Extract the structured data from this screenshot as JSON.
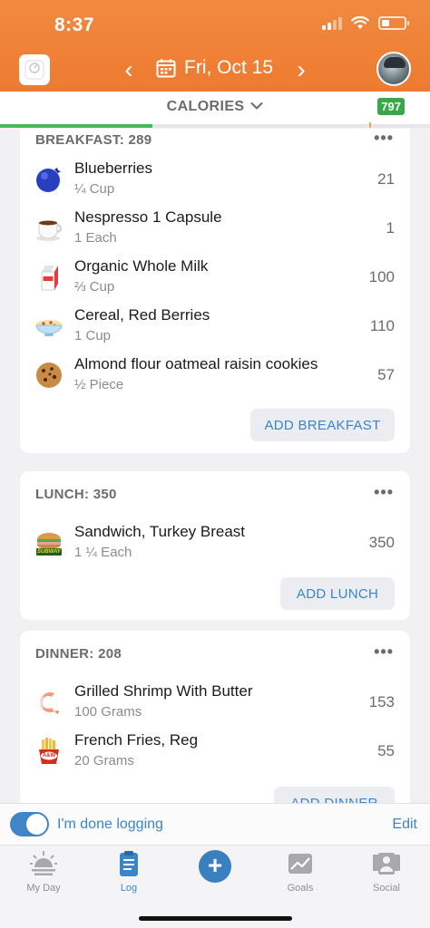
{
  "status_bar": {
    "time": "8:37"
  },
  "header": {
    "date_label": "Fri, Oct 15",
    "prev_glyph": "‹",
    "next_glyph": "›"
  },
  "metric": {
    "label": "CALORIES",
    "remaining_badge": "797",
    "progress_fraction": 0.355
  },
  "meals": {
    "breakfast": {
      "title": "BREAKFAST: 289",
      "more": "•••",
      "add_label": "ADD BREAKFAST",
      "items": [
        {
          "name": "Blueberries",
          "serving": "¼ Cup",
          "calories": "21",
          "icon": "blueberry-icon"
        },
        {
          "name": "Nespresso 1 Capsule",
          "serving": "1 Each",
          "calories": "1",
          "icon": "coffee-cup-icon"
        },
        {
          "name": "Organic Whole Milk",
          "serving": "⅔ Cup",
          "calories": "100",
          "icon": "milk-carton-icon"
        },
        {
          "name": "Cereal, Red Berries",
          "serving": "1 Cup",
          "calories": "110",
          "icon": "cereal-bowl-icon"
        },
        {
          "name": "Almond flour oatmeal raisin cookies",
          "serving": "½ Piece",
          "calories": "57",
          "icon": "cookie-icon"
        }
      ]
    },
    "lunch": {
      "title": "LUNCH: 350",
      "more": "•••",
      "add_label": "ADD LUNCH",
      "items": [
        {
          "name": "Sandwich, Turkey Breast",
          "serving": "1 ¼ Each",
          "calories": "350",
          "icon": "subway-sandwich-icon",
          "logo_text": "SUBWAY"
        }
      ]
    },
    "dinner": {
      "title": "DINNER: 208",
      "more": "•••",
      "add_label": "ADD DINNER",
      "items": [
        {
          "name": "Grilled Shrimp With Butter",
          "serving": "100 Grams",
          "calories": "153",
          "icon": "shrimp-icon"
        },
        {
          "name": "French Fries, Reg",
          "serving": "20 Grams",
          "calories": "55",
          "icon": "aw-fries-icon",
          "logo_text": "A&W"
        }
      ]
    }
  },
  "done_bar": {
    "label": "I'm done logging",
    "edit": "Edit",
    "toggle_on": true
  },
  "tabs": [
    {
      "label": "My Day",
      "icon": "sunrise-icon"
    },
    {
      "label": "Log",
      "icon": "clipboard-icon",
      "active": true
    },
    {
      "label": "",
      "icon": "plus-icon"
    },
    {
      "label": "Goals",
      "icon": "goals-chart-icon"
    },
    {
      "label": "Social",
      "icon": "social-people-icon"
    }
  ],
  "colors": {
    "header": "#ee7a30",
    "accent": "#3a86c8",
    "badge": "#3aa74a",
    "progress": "#3fbd5e"
  }
}
